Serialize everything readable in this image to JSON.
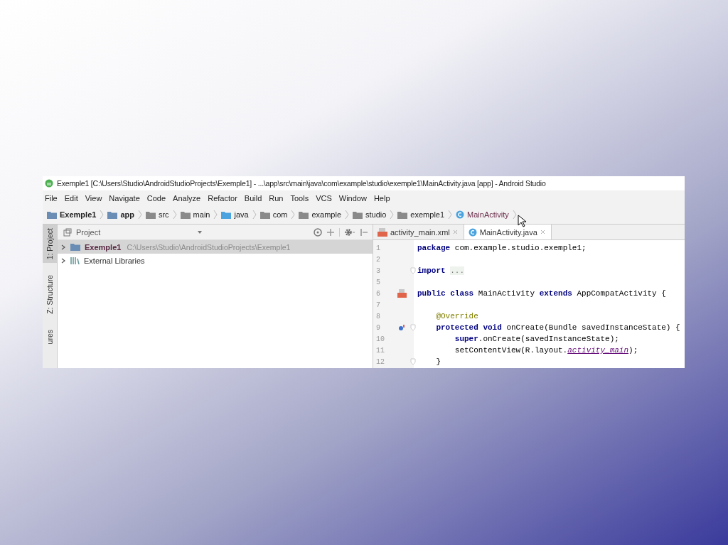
{
  "window": {
    "title": "Exemple1 [C:\\Users\\Studio\\AndroidStudioProjects\\Exemple1] - ...\\app\\src\\main\\java\\com\\example\\studio\\exemple1\\MainActivity.java [app] - Android Studio"
  },
  "menu": [
    "File",
    "Edit",
    "View",
    "Navigate",
    "Code",
    "Analyze",
    "Refactor",
    "Build",
    "Run",
    "Tools",
    "VCS",
    "Window",
    "Help"
  ],
  "breadcrumbs": [
    {
      "label": "Exemple1",
      "kind": "project"
    },
    {
      "label": "app",
      "kind": "module"
    },
    {
      "label": "src",
      "kind": "folder"
    },
    {
      "label": "main",
      "kind": "folder"
    },
    {
      "label": "java",
      "kind": "source"
    },
    {
      "label": "com",
      "kind": "package"
    },
    {
      "label": "example",
      "kind": "package"
    },
    {
      "label": "studio",
      "kind": "package"
    },
    {
      "label": "exemple1",
      "kind": "package"
    },
    {
      "label": "MainActivity",
      "kind": "class"
    }
  ],
  "side_tabs": [
    {
      "label": "1: Project",
      "selected": true
    },
    {
      "label": "Z: Structure",
      "selected": false
    },
    {
      "label": "ures",
      "selected": false
    }
  ],
  "project_panel": {
    "title": "Project",
    "tree": [
      {
        "label": "Exemple1",
        "path": "C:\\Users\\Studio\\AndroidStudioProjects\\Exemple1",
        "kind": "project",
        "expanded": false,
        "selected": true
      },
      {
        "label": "External Libraries",
        "kind": "libraries",
        "expanded": false,
        "selected": false
      }
    ]
  },
  "editor_tabs": [
    {
      "label": "activity_main.xml",
      "kind": "xml",
      "selected": false
    },
    {
      "label": "MainActivity.java",
      "kind": "class",
      "selected": true
    }
  ],
  "code": [
    {
      "number": "1",
      "fold": false,
      "tokens": [
        {
          "text": "package",
          "kind": "keyword"
        },
        {
          "text": " com.example.studio.exemple1;",
          "kind": "plain"
        }
      ]
    },
    {
      "number": "2",
      "fold": false
    },
    {
      "number": "3",
      "fold": true,
      "tokens": [
        {
          "text": "import",
          "kind": "keyword"
        },
        {
          "text": "...",
          "kind": "folded"
        }
      ]
    },
    {
      "number": "5",
      "fold": false
    },
    {
      "number": "6",
      "fold": false,
      "gutter": {
        "kind": "layout"
      },
      "tokens": [
        {
          "text": "public class",
          "kind": "keyword"
        },
        {
          "text": " MainActivity ",
          "kind": "plain"
        },
        {
          "text": "extends",
          "kind": "keyword"
        },
        {
          "text": " AppCompatActivity {",
          "kind": "plain"
        }
      ]
    },
    {
      "number": "7",
      "fold": false
    },
    {
      "number": "8",
      "fold": false,
      "kind": "member",
      "tokens": [
        {
          "text": "@Override",
          "kind": "annotation"
        }
      ]
    },
    {
      "number": "9",
      "fold": true,
      "kind": "member",
      "gutter": {
        "kind": "override"
      },
      "tokens": [
        {
          "text": "protected void",
          "kind": "keyword"
        },
        {
          "text": " onCreate(Bundle savedInstanceState) {",
          "kind": "plain"
        }
      ]
    },
    {
      "number": "10",
      "fold": false,
      "kind": "statement",
      "tokens": [
        {
          "text": "super",
          "kind": "keyword"
        },
        {
          "text": ".onCreate(savedInstanceState);",
          "kind": "plain"
        }
      ]
    },
    {
      "number": "11",
      "fold": false,
      "kind": "statement",
      "tokens": [
        {
          "text": "setContentView(R.layout.",
          "kind": "plain"
        },
        {
          "text": "activity_main",
          "kind": "field"
        },
        {
          "text": ");",
          "kind": "plain"
        }
      ]
    },
    {
      "number": "12",
      "fold": true,
      "kind": "member",
      "tokens": [
        {
          "text": "}",
          "kind": "plain"
        }
      ]
    }
  ]
}
